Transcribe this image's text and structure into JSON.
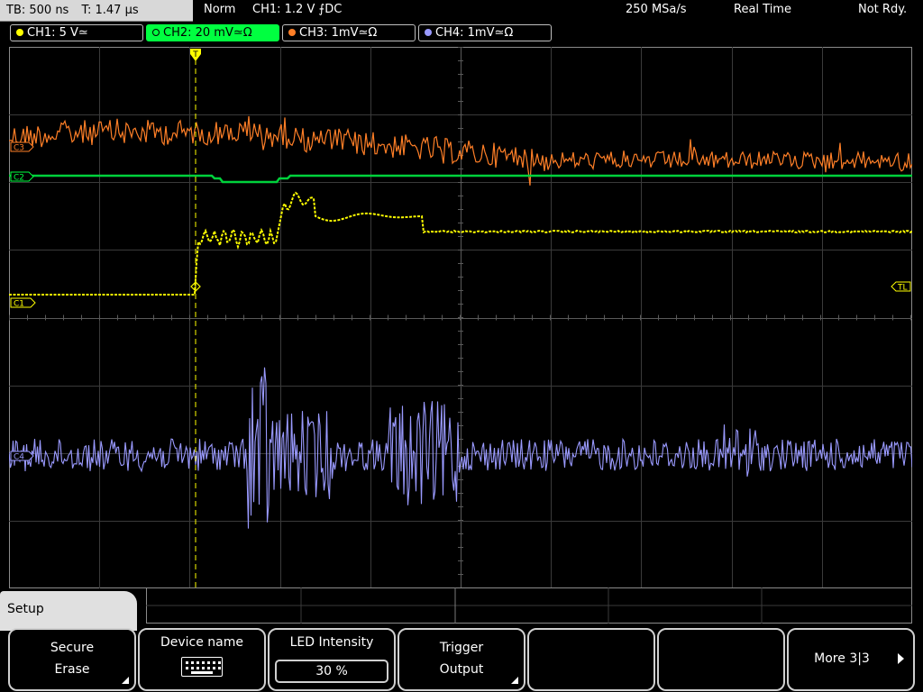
{
  "timebase": {
    "tb": "TB: 500 ns",
    "t": "T: 1.47 µs"
  },
  "status": {
    "mode": "Norm",
    "trigger": "CH1: 1.2 V ⨍DC",
    "sample_rate": "250 MSa/s",
    "acq": "Real Time",
    "ready": "Not Rdy."
  },
  "channels": [
    {
      "label": "CH1: 5 V≃",
      "color": "#ffff00"
    },
    {
      "label": "CH2: 20 mV≃Ω",
      "color": "#00ff40",
      "active": true
    },
    {
      "label": "CH3: 1mV≃Ω",
      "color": "#ff7f27"
    },
    {
      "label": "CH4: 1mV≃Ω",
      "color": "#9a9aff"
    }
  ],
  "markers": {
    "c1": "C1",
    "c2": "C2",
    "c3": "C3",
    "c4": "C4",
    "tl": "TL",
    "trig": "T"
  },
  "softkeys": {
    "menu_title": "Setup",
    "secure_erase": {
      "l1": "Secure",
      "l2": "Erase"
    },
    "device_name": {
      "l1": "Device name"
    },
    "led_intensity": {
      "l1": "LED Intensity",
      "value": "30 %"
    },
    "trigger_output": {
      "l1": "Trigger",
      "l2": "Output"
    },
    "more": {
      "l1": "More 3|3"
    }
  }
}
